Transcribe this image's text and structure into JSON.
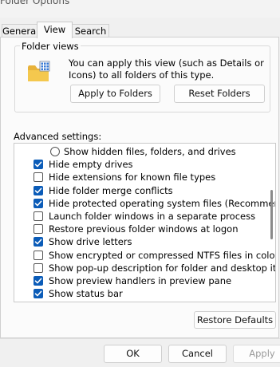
{
  "window": {
    "title": "Folder Options"
  },
  "tabs": [
    {
      "label": "General"
    },
    {
      "label": "View"
    },
    {
      "label": "Search"
    }
  ],
  "active_tab": "View",
  "folder_views": {
    "title": "Folder views",
    "description": "You can apply this view (such as Details or Icons) to all folders of this type.",
    "apply_label": "Apply to Folders",
    "reset_label": "Reset Folders",
    "icon": "folder-grid-icon"
  },
  "advanced": {
    "label": "Advanced settings:",
    "items": [
      {
        "type": "radio",
        "label": "Show hidden files, folders, and drives",
        "checked": false
      },
      {
        "type": "checkbox",
        "label": "Hide empty drives",
        "checked": true
      },
      {
        "type": "checkbox",
        "label": "Hide extensions for known file types",
        "checked": false
      },
      {
        "type": "checkbox",
        "label": "Hide folder merge conflicts",
        "checked": true
      },
      {
        "type": "checkbox",
        "label": "Hide protected operating system files (Recommended)",
        "checked": true
      },
      {
        "type": "checkbox",
        "label": "Launch folder windows in a separate process",
        "checked": false
      },
      {
        "type": "checkbox",
        "label": "Restore previous folder windows at logon",
        "checked": false
      },
      {
        "type": "checkbox",
        "label": "Show drive letters",
        "checked": true
      },
      {
        "type": "checkbox",
        "label": "Show encrypted or compressed NTFS files in color",
        "checked": false
      },
      {
        "type": "checkbox",
        "label": "Show pop-up description for folder and desktop items",
        "checked": false
      },
      {
        "type": "checkbox",
        "label": "Show preview handlers in preview pane",
        "checked": true
      },
      {
        "type": "checkbox",
        "label": "Show status bar",
        "checked": true
      }
    ]
  },
  "restore_defaults_label": "Restore Defaults",
  "footer": {
    "ok_label": "OK",
    "cancel_label": "Cancel",
    "apply_label": "Apply"
  },
  "colors": {
    "accent": "#0b5cb8",
    "panel_bg": "#fbfbfb",
    "window_bg": "#f0f0f0"
  }
}
